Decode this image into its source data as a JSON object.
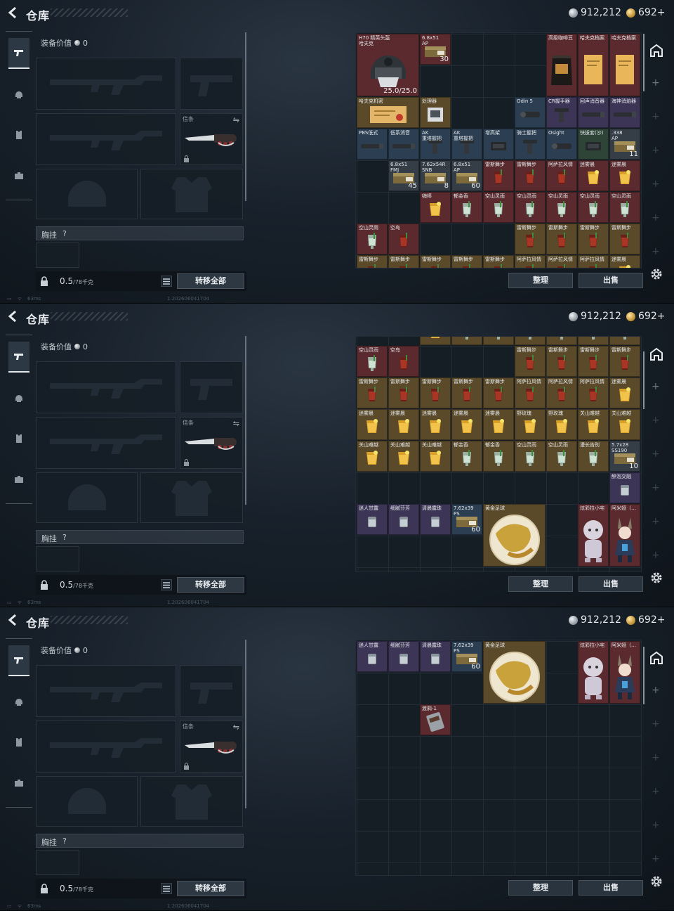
{
  "header": {
    "title": "仓库",
    "silver": "912,212",
    "gold": "692+"
  },
  "equip": {
    "value_label": "装备价值",
    "value": "0",
    "knife_tag": "信条",
    "chest_label": "胸挂",
    "chest_help": "?",
    "weight": "0.5",
    "weight_max": "/78千克",
    "transfer_label": "转移全部"
  },
  "status": {
    "ping": "63ms",
    "version": "1.202606041704"
  },
  "actions": {
    "sort": "整理",
    "sell": "出售"
  },
  "grid1": [
    {
      "c": 0,
      "r": 0,
      "w": 2,
      "h": 2,
      "n": "H70 精英头盔\n哈夫克",
      "q": "25.0/25.0",
      "bg": "bg-red",
      "i": "helmet"
    },
    {
      "c": 2,
      "r": 0,
      "w": 1,
      "h": 1,
      "n": "6.8x51\nAP",
      "q": "30",
      "bg": "bg-red",
      "i": "ammo"
    },
    {
      "c": 6,
      "r": 0,
      "w": 1,
      "h": 2,
      "n": "高级咖啡豆",
      "q": "",
      "bg": "bg-red",
      "i": "coffee"
    },
    {
      "c": 7,
      "r": 0,
      "w": 1,
      "h": 2,
      "n": "哈夫克档案",
      "q": "",
      "bg": "bg-red",
      "i": "file"
    },
    {
      "c": 8,
      "r": 0,
      "w": 1,
      "h": 2,
      "n": "哈夫克档案",
      "q": "",
      "bg": "bg-red",
      "i": "file"
    },
    {
      "c": 0,
      "r": 2,
      "w": 2,
      "h": 1,
      "n": "哈夫克机密",
      "q": "",
      "bg": "bg-gold",
      "i": "doc"
    },
    {
      "c": 2,
      "r": 2,
      "w": 1,
      "h": 1,
      "n": "处理器",
      "q": "",
      "bg": "bg-gold",
      "i": "chip"
    },
    {
      "c": 5,
      "r": 2,
      "w": 1,
      "h": 1,
      "n": "Odin 5",
      "q": "",
      "bg": "bg-blue",
      "i": "scope"
    },
    {
      "c": 6,
      "r": 2,
      "w": 1,
      "h": 1,
      "n": "CR握手器",
      "q": "",
      "bg": "bg-purple",
      "i": "grip"
    },
    {
      "c": 7,
      "r": 2,
      "w": 1,
      "h": 1,
      "n": "回声消音器",
      "q": "",
      "bg": "bg-purple",
      "i": "supp"
    },
    {
      "c": 8,
      "r": 2,
      "w": 1,
      "h": 1,
      "n": "海神消焰器",
      "q": "",
      "bg": "bg-purple",
      "i": "supp"
    },
    {
      "c": 0,
      "r": 3,
      "w": 1,
      "h": 1,
      "n": "PBS低式",
      "q": "",
      "bg": "bg-blue",
      "i": "supp"
    },
    {
      "c": 1,
      "r": 3,
      "w": 1,
      "h": 1,
      "n": "低系消音",
      "q": "",
      "bg": "bg-blue",
      "i": "supp"
    },
    {
      "c": 2,
      "r": 3,
      "w": 1,
      "h": 1,
      "n": "AK\n重塔握把",
      "q": "",
      "bg": "bg-blue",
      "i": "grip"
    },
    {
      "c": 3,
      "r": 3,
      "w": 1,
      "h": 1,
      "n": "AK\n重塔握把",
      "q": "",
      "bg": "bg-blue",
      "i": "grip"
    },
    {
      "c": 4,
      "r": 3,
      "w": 1,
      "h": 1,
      "n": "增高架",
      "q": "",
      "bg": "bg-blue",
      "i": "mount"
    },
    {
      "c": 5,
      "r": 3,
      "w": 1,
      "h": 1,
      "n": "骑士握把",
      "q": "",
      "bg": "bg-blue",
      "i": "grip"
    },
    {
      "c": 6,
      "r": 3,
      "w": 1,
      "h": 1,
      "n": "Osight",
      "q": "",
      "bg": "bg-blue",
      "i": "scope"
    },
    {
      "c": 7,
      "r": 3,
      "w": 1,
      "h": 1,
      "n": "快拔套(沙)",
      "q": "",
      "bg": "bg-green",
      "i": "mount"
    },
    {
      "c": 8,
      "r": 3,
      "w": 1,
      "h": 1,
      "n": ".338\nAP",
      "q": "11",
      "bg": "bg-gray",
      "i": "ammo"
    },
    {
      "c": 1,
      "r": 4,
      "w": 1,
      "h": 1,
      "n": "6.8x51\nFMJ",
      "q": "45",
      "bg": "bg-gray",
      "i": "ammo"
    },
    {
      "c": 2,
      "r": 4,
      "w": 1,
      "h": 1,
      "n": "7.62x54R\nSNB",
      "q": "8",
      "bg": "bg-gray",
      "i": "ammo"
    },
    {
      "c": 3,
      "r": 4,
      "w": 1,
      "h": 1,
      "n": "6.8x51\nAP",
      "q": "60",
      "bg": "bg-gray",
      "i": "ammo"
    },
    {
      "c": 4,
      "r": 4,
      "w": 1,
      "h": 1,
      "n": "雷斯舞步",
      "q": "",
      "bg": "bg-red",
      "i": "drinkred"
    },
    {
      "c": 5,
      "r": 4,
      "w": 1,
      "h": 1,
      "n": "雷斯舞步",
      "q": "",
      "bg": "bg-red",
      "i": "drinkred"
    },
    {
      "c": 6,
      "r": 4,
      "w": 1,
      "h": 1,
      "n": "阿萨拉风情",
      "q": "",
      "bg": "bg-red",
      "i": "drinkred"
    },
    {
      "c": 7,
      "r": 4,
      "w": 1,
      "h": 1,
      "n": "迷雾晨",
      "q": "",
      "bg": "bg-red",
      "i": "drinkyel"
    },
    {
      "c": 8,
      "r": 4,
      "w": 1,
      "h": 1,
      "n": "迷雾晨",
      "q": "",
      "bg": "bg-red",
      "i": "drinkyel"
    },
    {
      "c": 2,
      "r": 5,
      "w": 1,
      "h": 1,
      "n": "嗨棒",
      "q": "",
      "bg": "bg-red",
      "i": "drinkyel"
    },
    {
      "c": 3,
      "r": 5,
      "w": 1,
      "h": 1,
      "n": "郁金香",
      "q": "",
      "bg": "bg-red",
      "i": "drinkgrn"
    },
    {
      "c": 4,
      "r": 5,
      "w": 1,
      "h": 1,
      "n": "空山灵雨",
      "q": "",
      "bg": "bg-red",
      "i": "drinkgrn"
    },
    {
      "c": 5,
      "r": 5,
      "w": 1,
      "h": 1,
      "n": "空山灵雨",
      "q": "",
      "bg": "bg-red",
      "i": "drinkgrn"
    },
    {
      "c": 6,
      "r": 5,
      "w": 1,
      "h": 1,
      "n": "空山灵雨",
      "q": "",
      "bg": "bg-red",
      "i": "drinkgrn"
    },
    {
      "c": 7,
      "r": 5,
      "w": 1,
      "h": 1,
      "n": "空山灵雨",
      "q": "",
      "bg": "bg-red",
      "i": "drinkgrn"
    },
    {
      "c": 8,
      "r": 5,
      "w": 1,
      "h": 1,
      "n": "空山灵雨",
      "q": "",
      "bg": "bg-red",
      "i": "drinkgrn"
    },
    {
      "c": 0,
      "r": 6,
      "w": 1,
      "h": 1,
      "n": "空山灵雨",
      "q": "",
      "bg": "bg-red",
      "i": "drinkgrn"
    },
    {
      "c": 1,
      "r": 6,
      "w": 1,
      "h": 1,
      "n": "空岛",
      "q": "",
      "bg": "bg-red",
      "i": "drinkred"
    },
    {
      "c": 5,
      "r": 6,
      "w": 1,
      "h": 1,
      "n": "雷斯舞步",
      "q": "",
      "bg": "bg-gold",
      "i": "drinkred"
    },
    {
      "c": 6,
      "r": 6,
      "w": 1,
      "h": 1,
      "n": "雷斯舞步",
      "q": "",
      "bg": "bg-gold",
      "i": "drinkred"
    },
    {
      "c": 7,
      "r": 6,
      "w": 1,
      "h": 1,
      "n": "雷斯舞步",
      "q": "",
      "bg": "bg-gold",
      "i": "drinkred"
    },
    {
      "c": 8,
      "r": 6,
      "w": 1,
      "h": 1,
      "n": "雷斯舞步",
      "q": "",
      "bg": "bg-gold",
      "i": "drinkred"
    },
    {
      "c": 0,
      "r": 7,
      "w": 1,
      "h": 1,
      "n": "雷斯舞步",
      "q": "",
      "bg": "bg-gold",
      "i": "drinkred"
    },
    {
      "c": 1,
      "r": 7,
      "w": 1,
      "h": 1,
      "n": "雷斯舞步",
      "q": "",
      "bg": "bg-gold",
      "i": "drinkred"
    },
    {
      "c": 2,
      "r": 7,
      "w": 1,
      "h": 1,
      "n": "雷斯舞步",
      "q": "",
      "bg": "bg-gold",
      "i": "drinkred"
    },
    {
      "c": 3,
      "r": 7,
      "w": 1,
      "h": 1,
      "n": "雷斯舞步",
      "q": "",
      "bg": "bg-gold",
      "i": "drinkred"
    },
    {
      "c": 4,
      "r": 7,
      "w": 1,
      "h": 1,
      "n": "雷斯舞步",
      "q": "",
      "bg": "bg-gold",
      "i": "drinkred"
    },
    {
      "c": 5,
      "r": 7,
      "w": 1,
      "h": 1,
      "n": "阿萨拉风情",
      "q": "",
      "bg": "bg-gold",
      "i": "drinkred"
    },
    {
      "c": 6,
      "r": 7,
      "w": 1,
      "h": 1,
      "n": "阿萨拉风情",
      "q": "",
      "bg": "bg-gold",
      "i": "drinkred"
    },
    {
      "c": 7,
      "r": 7,
      "w": 1,
      "h": 1,
      "n": "阿萨拉风情",
      "q": "",
      "bg": "bg-gold",
      "i": "drinkred"
    },
    {
      "c": 8,
      "r": 7,
      "w": 1,
      "h": 1,
      "n": "迷雾晨",
      "q": "",
      "bg": "bg-gold",
      "i": "drinkyel"
    }
  ],
  "grid2": [
    {
      "c": 2,
      "r": -1,
      "w": 1,
      "h": 1,
      "n": "",
      "q": "",
      "bg": "bg-gold",
      "i": "drinkyel"
    },
    {
      "c": 3,
      "r": -1,
      "w": 1,
      "h": 1,
      "n": "",
      "q": "",
      "bg": "bg-gold",
      "i": "drinkgrn"
    },
    {
      "c": 4,
      "r": -1,
      "w": 1,
      "h": 1,
      "n": "",
      "q": "",
      "bg": "bg-gold",
      "i": "drinkgrn"
    },
    {
      "c": 5,
      "r": -1,
      "w": 1,
      "h": 1,
      "n": "",
      "q": "",
      "bg": "bg-gold",
      "i": "drinkgrn"
    },
    {
      "c": 6,
      "r": -1,
      "w": 1,
      "h": 1,
      "n": "",
      "q": "",
      "bg": "bg-gold",
      "i": "drinkgrn"
    },
    {
      "c": 7,
      "r": -1,
      "w": 1,
      "h": 1,
      "n": "",
      "q": "",
      "bg": "bg-gold",
      "i": "drinkgrn"
    },
    {
      "c": 8,
      "r": -1,
      "w": 1,
      "h": 1,
      "n": "",
      "q": "",
      "bg": "bg-gold",
      "i": "drinkgrn"
    },
    {
      "c": 0,
      "r": 0,
      "w": 1,
      "h": 1,
      "n": "空山灵雨",
      "q": "",
      "bg": "bg-red",
      "i": "drinkgrn"
    },
    {
      "c": 1,
      "r": 0,
      "w": 1,
      "h": 1,
      "n": "空岛",
      "q": "",
      "bg": "bg-red",
      "i": "drinkred"
    },
    {
      "c": 5,
      "r": 0,
      "w": 1,
      "h": 1,
      "n": "雷斯舞步",
      "q": "",
      "bg": "bg-gold",
      "i": "drinkred"
    },
    {
      "c": 6,
      "r": 0,
      "w": 1,
      "h": 1,
      "n": "雷斯舞步",
      "q": "",
      "bg": "bg-gold",
      "i": "drinkred"
    },
    {
      "c": 7,
      "r": 0,
      "w": 1,
      "h": 1,
      "n": "雷斯舞步",
      "q": "",
      "bg": "bg-gold",
      "i": "drinkred"
    },
    {
      "c": 8,
      "r": 0,
      "w": 1,
      "h": 1,
      "n": "雷斯舞步",
      "q": "",
      "bg": "bg-gold",
      "i": "drinkred"
    },
    {
      "c": 0,
      "r": 1,
      "w": 1,
      "h": 1,
      "n": "雷斯舞步",
      "q": "",
      "bg": "bg-gold",
      "i": "drinkred"
    },
    {
      "c": 1,
      "r": 1,
      "w": 1,
      "h": 1,
      "n": "雷斯舞步",
      "q": "",
      "bg": "bg-gold",
      "i": "drinkred"
    },
    {
      "c": 2,
      "r": 1,
      "w": 1,
      "h": 1,
      "n": "雷斯舞步",
      "q": "",
      "bg": "bg-gold",
      "i": "drinkred"
    },
    {
      "c": 3,
      "r": 1,
      "w": 1,
      "h": 1,
      "n": "雷斯舞步",
      "q": "",
      "bg": "bg-gold",
      "i": "drinkred"
    },
    {
      "c": 4,
      "r": 1,
      "w": 1,
      "h": 1,
      "n": "雷斯舞步",
      "q": "",
      "bg": "bg-gold",
      "i": "drinkred"
    },
    {
      "c": 5,
      "r": 1,
      "w": 1,
      "h": 1,
      "n": "阿萨拉风情",
      "q": "",
      "bg": "bg-gold",
      "i": "drinkred"
    },
    {
      "c": 6,
      "r": 1,
      "w": 1,
      "h": 1,
      "n": "阿萨拉风情",
      "q": "",
      "bg": "bg-gold",
      "i": "drinkred"
    },
    {
      "c": 7,
      "r": 1,
      "w": 1,
      "h": 1,
      "n": "阿萨拉风情",
      "q": "",
      "bg": "bg-gold",
      "i": "drinkred"
    },
    {
      "c": 8,
      "r": 1,
      "w": 1,
      "h": 1,
      "n": "迷雾晨",
      "q": "",
      "bg": "bg-gold",
      "i": "drinkyel"
    },
    {
      "c": 0,
      "r": 2,
      "w": 1,
      "h": 1,
      "n": "迷雾晨",
      "q": "",
      "bg": "bg-gold",
      "i": "drinkyel"
    },
    {
      "c": 1,
      "r": 2,
      "w": 1,
      "h": 1,
      "n": "迷雾晨",
      "q": "",
      "bg": "bg-gold",
      "i": "drinkyel"
    },
    {
      "c": 2,
      "r": 2,
      "w": 1,
      "h": 1,
      "n": "迷雾晨",
      "q": "",
      "bg": "bg-gold",
      "i": "drinkyel"
    },
    {
      "c": 3,
      "r": 2,
      "w": 1,
      "h": 1,
      "n": "迷雾晨",
      "q": "",
      "bg": "bg-gold",
      "i": "drinkyel"
    },
    {
      "c": 4,
      "r": 2,
      "w": 1,
      "h": 1,
      "n": "迷雾晨",
      "q": "",
      "bg": "bg-gold",
      "i": "drinkyel"
    },
    {
      "c": 5,
      "r": 2,
      "w": 1,
      "h": 1,
      "n": "野玫瑰",
      "q": "",
      "bg": "bg-gold",
      "i": "drinkyel"
    },
    {
      "c": 6,
      "r": 2,
      "w": 1,
      "h": 1,
      "n": "野玫瑰",
      "q": "",
      "bg": "bg-gold",
      "i": "drinkyel"
    },
    {
      "c": 7,
      "r": 2,
      "w": 1,
      "h": 1,
      "n": "关山难越",
      "q": "",
      "bg": "bg-gold",
      "i": "drinkyel"
    },
    {
      "c": 8,
      "r": 2,
      "w": 1,
      "h": 1,
      "n": "关山难越",
      "q": "",
      "bg": "bg-gold",
      "i": "drinkyel"
    },
    {
      "c": 0,
      "r": 3,
      "w": 1,
      "h": 1,
      "n": "关山难越",
      "q": "",
      "bg": "bg-gold",
      "i": "drinkyel"
    },
    {
      "c": 1,
      "r": 3,
      "w": 1,
      "h": 1,
      "n": "关山难越",
      "q": "",
      "bg": "bg-gold",
      "i": "drinkyel"
    },
    {
      "c": 2,
      "r": 3,
      "w": 1,
      "h": 1,
      "n": "关山难越",
      "q": "",
      "bg": "bg-gold",
      "i": "drinkyel"
    },
    {
      "c": 3,
      "r": 3,
      "w": 1,
      "h": 1,
      "n": "郁金香",
      "q": "",
      "bg": "bg-gold",
      "i": "drinkgrn"
    },
    {
      "c": 4,
      "r": 3,
      "w": 1,
      "h": 1,
      "n": "郁金香",
      "q": "",
      "bg": "bg-gold",
      "i": "drinkgrn"
    },
    {
      "c": 5,
      "r": 3,
      "w": 1,
      "h": 1,
      "n": "空山灵雨",
      "q": "",
      "bg": "bg-gold",
      "i": "drinkgrn"
    },
    {
      "c": 6,
      "r": 3,
      "w": 1,
      "h": 1,
      "n": "空山灵雨",
      "q": "",
      "bg": "bg-gold",
      "i": "drinkgrn"
    },
    {
      "c": 7,
      "r": 3,
      "w": 1,
      "h": 1,
      "n": "漫长告别",
      "q": "",
      "bg": "bg-gold",
      "i": "drinkgrn"
    },
    {
      "c": 8,
      "r": 3,
      "w": 1,
      "h": 1,
      "n": "5.7x28\nSS190",
      "q": "10",
      "bg": "bg-gray",
      "i": "ammo"
    },
    {
      "c": 8,
      "r": 4,
      "w": 1,
      "h": 1,
      "n": "醉泡交融",
      "q": "",
      "bg": "bg-purple",
      "i": "glass"
    },
    {
      "c": 0,
      "r": 5,
      "w": 1,
      "h": 1,
      "n": "迷人甘露",
      "q": "",
      "bg": "bg-purple",
      "i": "glass"
    },
    {
      "c": 1,
      "r": 5,
      "w": 1,
      "h": 1,
      "n": "细腻芬芳",
      "q": "",
      "bg": "bg-purple",
      "i": "glass"
    },
    {
      "c": 2,
      "r": 5,
      "w": 1,
      "h": 1,
      "n": "清晨露珠",
      "q": "",
      "bg": "bg-purple",
      "i": "glass"
    },
    {
      "c": 3,
      "r": 5,
      "w": 1,
      "h": 1,
      "n": "7.62x39\nPS",
      "q": "60",
      "bg": "bg-blue",
      "i": "ammo"
    },
    {
      "c": 4,
      "r": 5,
      "w": 2,
      "h": 2,
      "n": "黄金足球",
      "q": "",
      "bg": "bg-gold",
      "i": "ball"
    },
    {
      "c": 7,
      "r": 5,
      "w": 1,
      "h": 2,
      "n": "炫彩拉小宅",
      "q": "",
      "bg": "bg-red",
      "i": "doll"
    },
    {
      "c": 8,
      "r": 5,
      "w": 1,
      "h": 2,
      "n": "阿米娅（…",
      "q": "",
      "bg": "bg-red",
      "i": "bunny"
    }
  ],
  "grid3": [
    {
      "c": 0,
      "r": 0,
      "w": 1,
      "h": 1,
      "n": "迷人甘露",
      "q": "",
      "bg": "bg-purple",
      "i": "glass"
    },
    {
      "c": 1,
      "r": 0,
      "w": 1,
      "h": 1,
      "n": "细腻芬芳",
      "q": "",
      "bg": "bg-purple",
      "i": "glass"
    },
    {
      "c": 2,
      "r": 0,
      "w": 1,
      "h": 1,
      "n": "清晨露珠",
      "q": "",
      "bg": "bg-purple",
      "i": "glass"
    },
    {
      "c": 3,
      "r": 0,
      "w": 1,
      "h": 1,
      "n": "7.62x39\nPS",
      "q": "60",
      "bg": "bg-blue",
      "i": "ammo"
    },
    {
      "c": 4,
      "r": 0,
      "w": 2,
      "h": 2,
      "n": "黄金足球",
      "q": "",
      "bg": "bg-gold",
      "i": "ball"
    },
    {
      "c": 7,
      "r": 0,
      "w": 1,
      "h": 2,
      "n": "炫彩拉小宅",
      "q": "",
      "bg": "bg-red",
      "i": "doll"
    },
    {
      "c": 8,
      "r": 0,
      "w": 1,
      "h": 2,
      "n": "阿米娅（…",
      "q": "",
      "bg": "bg-red",
      "i": "bunny"
    },
    {
      "c": 2,
      "r": 2,
      "w": 1,
      "h": 1,
      "n": "渡鸦-1",
      "q": "",
      "bg": "bg-red",
      "i": "card"
    }
  ]
}
